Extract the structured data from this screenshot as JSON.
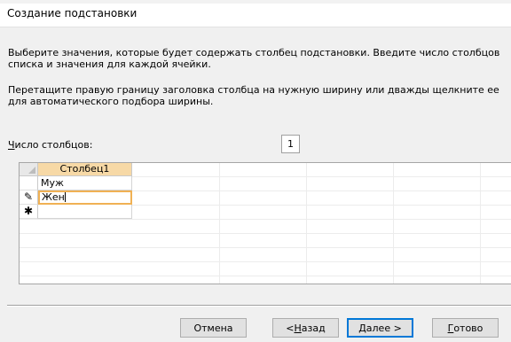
{
  "window": {
    "title": "Создание подстановки"
  },
  "instructions": {
    "line1": "Выберите значения, которые будет содержать столбец подстановки. Введите число столбцов списка и значения для каждой ячейки.",
    "line2": "Перетащите правую границу заголовка столбца на нужную ширину или дважды щелкните ее для автоматического подбора ширины."
  },
  "column_count": {
    "label_mnemonic": "Ч",
    "label_rest": "исло столбцов:",
    "value": "1"
  },
  "grid": {
    "column_header": "Столбец1",
    "rows": [
      {
        "selector": "",
        "value": "Муж"
      },
      {
        "selector": "✎",
        "value": "Жен",
        "editing": true
      },
      {
        "selector": "✱",
        "value": ""
      }
    ]
  },
  "buttons": {
    "cancel": "Отмена",
    "back_prefix": "< ",
    "back_mnemonic": "Н",
    "back_rest": "азад",
    "next_mnemonic": "Д",
    "next_rest": "алее >",
    "finish_mnemonic": "Г",
    "finish_rest": "отово"
  },
  "colors": {
    "accent": "#0078d7",
    "header_highlight": "#f7d9a6",
    "active_cell_border": "#f0b154"
  }
}
